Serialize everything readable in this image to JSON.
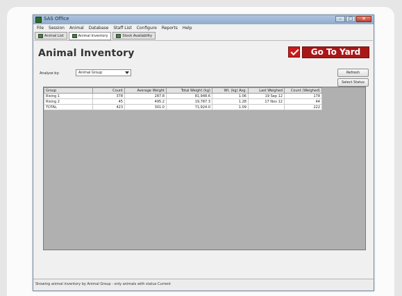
{
  "window": {
    "title": "SAS Office",
    "buttons": [
      "–",
      "□",
      "✕"
    ]
  },
  "menu": [
    "File",
    "Session",
    "Animal",
    "Database",
    "Staff List",
    "Configure",
    "Reports",
    "Help"
  ],
  "tabs": [
    {
      "label": "Animal List",
      "icon": "grid-icon",
      "active": false
    },
    {
      "label": "Animal Inventory",
      "icon": "grid-icon",
      "active": true
    },
    {
      "label": "Stock Availability",
      "icon": "grid-icon",
      "active": false
    }
  ],
  "page": {
    "title": "Animal Inventory",
    "go_button": "Go To Yard",
    "analyse_label": "Analyse by:",
    "analyse_value": "Animal Group",
    "refresh_button": "Refresh",
    "select_status_button": "Select Status"
  },
  "table": {
    "columns": [
      "Group",
      "Count",
      "Average Weight",
      "Total Weight (kg)",
      "Wt. (kg) Avg.",
      "Last Weighed",
      "Count (Weighed)"
    ],
    "rows": [
      [
        "Rising 1",
        "378",
        "287.8",
        "81,948.6",
        "1.06",
        "19 Sep 12",
        "178"
      ],
      [
        "Rising 2",
        "45",
        "495.2",
        "19,787.3",
        "1.28",
        "17 Nov 12",
        "44"
      ],
      [
        "TOTAL",
        "423",
        "301.0",
        "71,924.0",
        "1.09",
        "",
        "222"
      ]
    ]
  },
  "status": {
    "text": "Showing animal inventory by Animal Group - only animals with status Current"
  },
  "colors": {
    "accent": "#a81818",
    "grid_background": "#b0b0b0",
    "titlebar": "#9cb6d6"
  }
}
